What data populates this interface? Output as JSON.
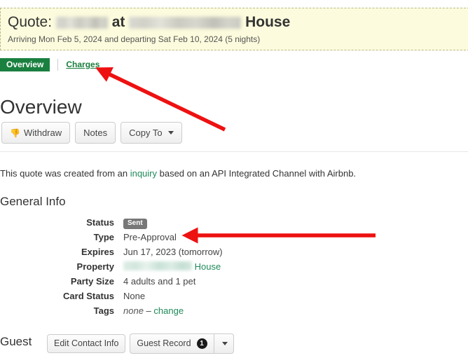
{
  "banner": {
    "title_prefix": "Quote:",
    "redacted_guest_name": "",
    "title_joiner": "at",
    "redacted_property_name": "",
    "title_suffix": "House",
    "subtitle": "Arriving Mon Feb 5, 2024 and departing Sat Feb 10, 2024 (5 nights)"
  },
  "tabs": {
    "active_label": "Overview",
    "charges_label": "Charges"
  },
  "page": {
    "title": "Overview"
  },
  "toolbar": {
    "withdraw_label": "Withdraw",
    "withdraw_icon": "thumbs-down-icon",
    "notes_label": "Notes",
    "copy_to_label": "Copy To",
    "copy_to_icon": "caret-down-icon"
  },
  "intro": {
    "part1": "This quote was created from an ",
    "link": "inquiry",
    "part2": " based on an API Integrated Channel with Airbnb."
  },
  "general_info": {
    "heading": "General Info",
    "rows": [
      {
        "label": "Status",
        "value": "Sent",
        "type": "badge"
      },
      {
        "label": "Type",
        "value": "Pre-Approval",
        "type": "text"
      },
      {
        "label": "Expires",
        "value": "Jun 17, 2023 (tomorrow)",
        "type": "text"
      },
      {
        "label": "Property",
        "value": "House",
        "type": "redacted-link"
      },
      {
        "label": "Party Size",
        "value": "4 adults and 1 pet",
        "type": "text"
      },
      {
        "label": "Card Status",
        "value": "None",
        "type": "text"
      },
      {
        "label": "Tags",
        "value": "none",
        "separator": "–",
        "link": "change",
        "type": "tags"
      }
    ]
  },
  "guest": {
    "heading": "Guest",
    "edit_contact_label": "Edit Contact Info",
    "guest_record_label": "Guest Record",
    "guest_record_count": "1",
    "dropdown_icon": "caret-down-icon"
  },
  "annotations": {
    "arrow_color": "#ee1111",
    "arrow_1_target": "Charges",
    "arrow_2_target": "Pre-Approval"
  },
  "colors": {
    "banner_bg": "#fcfbdd",
    "tab_active_bg": "#1a8040",
    "link_green": "#1f8a5b",
    "badge_gray": "#777777",
    "arrow_red": "#ee1111"
  }
}
